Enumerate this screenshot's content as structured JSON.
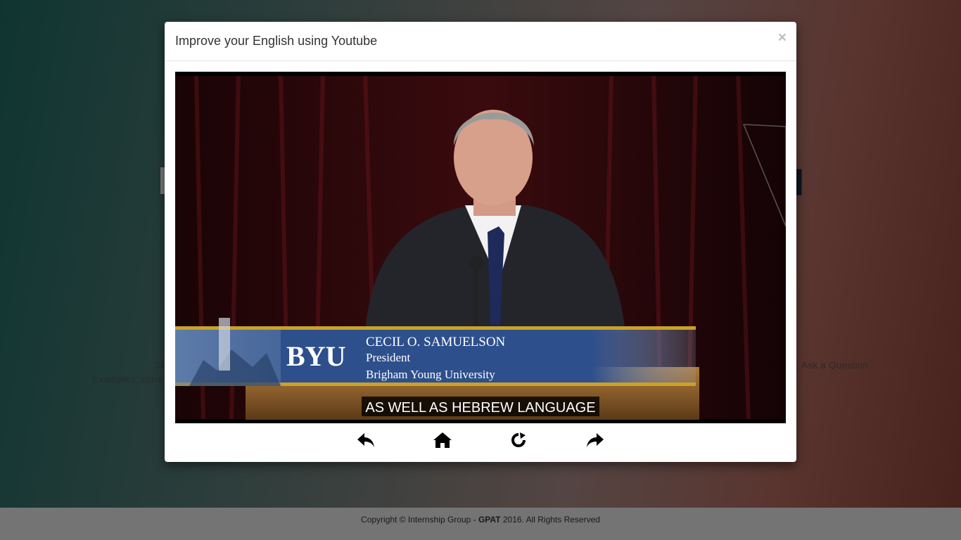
{
  "background": {
    "left_text_1": "Se",
    "left_text_2": "Examples: cons",
    "right_text": ", Ask a Question"
  },
  "footer": {
    "copyright_prefix": "Copyright © Internship Group - ",
    "brand": "GPAT",
    "copyright_suffix": " 2016. All Rights Reserved"
  },
  "modal": {
    "title": "Improve your English using Youtube",
    "close_symbol": "×"
  },
  "video": {
    "lower_third": {
      "logo": "BYU",
      "name": "CECIL O. SAMUELSON",
      "role": "President",
      "org": "Brigham Young University"
    },
    "caption": "AS WELL AS HEBREW LANGUAGE"
  },
  "controls": {
    "icons": [
      "back-icon",
      "home-icon",
      "refresh-icon",
      "forward-icon"
    ]
  },
  "colors": {
    "modal_bg": "#ffffff",
    "footer_bg": "#e9e9e9",
    "lower_third_blue": "#2d4f8c",
    "lower_third_gold": "#c9a227",
    "curtain": "#3a0b0e"
  }
}
